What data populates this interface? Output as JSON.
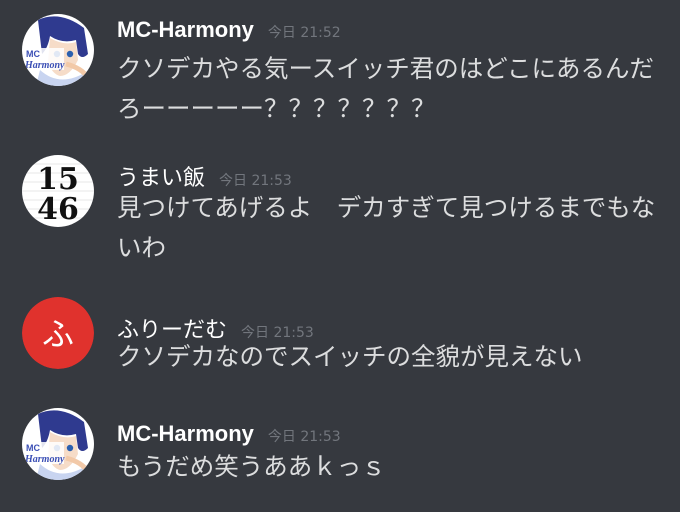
{
  "messages": [
    {
      "author": "MC-Harmony",
      "timestamp": "今日 21:52",
      "text": "クソデカやる気ースイッチ君のはどこにあるんだろーーーーー？？？？？？？",
      "avatar": {
        "type": "image",
        "icon": "anime-character-avatar",
        "logo_text": [
          "MC",
          "Harmony"
        ]
      }
    },
    {
      "author": "うまい飯",
      "timestamp": "今日 21:53",
      "text": "見つけてあげるよ　デカすぎて見つけるまでもないわ",
      "avatar": {
        "type": "image",
        "icon": "numbers-1546-avatar",
        "digits": [
          "15",
          "46"
        ]
      }
    },
    {
      "author": "ふりーだむ",
      "timestamp": "今日 21:53",
      "text": "クソデカなのでスイッチの全貌が見えない",
      "avatar": {
        "type": "image",
        "icon": "red-kana-avatar",
        "glyph": "ふ",
        "color": "#e0322d"
      }
    },
    {
      "author": "MC-Harmony",
      "timestamp": "今日 21:53",
      "text": "もうだめ笑うああｋっｓ",
      "avatar": {
        "type": "image",
        "icon": "anime-character-avatar",
        "logo_text": [
          "MC",
          "Harmony"
        ]
      }
    }
  ],
  "colors": {
    "background": "#36393f",
    "author": "#ffffff",
    "timestamp": "#72767d",
    "message_text": "#dcddde"
  }
}
